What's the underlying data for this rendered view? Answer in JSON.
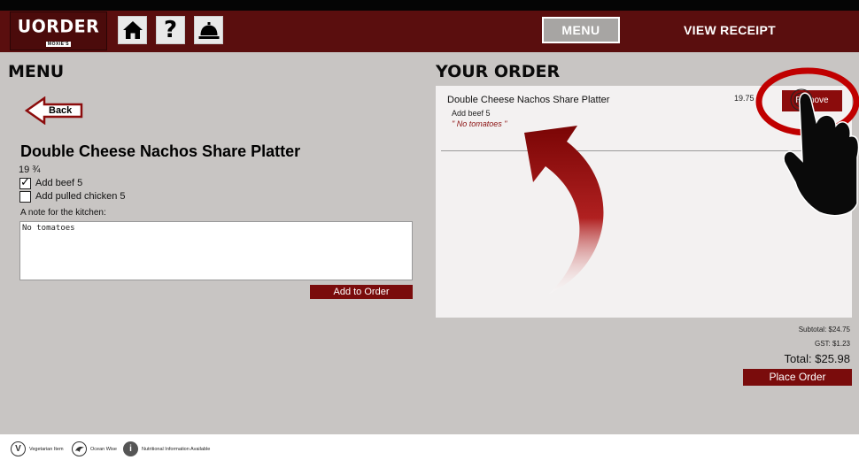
{
  "app": {
    "logo_text": "UORDER",
    "logo_sub": "MOXIE'S"
  },
  "header": {
    "icons": [
      "home-icon",
      "help-icon",
      "service-bell-icon"
    ],
    "help_glyph": "?",
    "menu_label": "MENU",
    "receipt_label": "VIEW RECEIPT"
  },
  "menu": {
    "heading": "MENU",
    "back_label": "Back",
    "item": {
      "title": "Double Cheese Nachos Share Platter",
      "price": "19 ¾",
      "options": [
        {
          "label": "Add beef 5",
          "checked": true
        },
        {
          "label": "Add pulled chicken 5",
          "checked": false
        }
      ],
      "note_label": "A note for the kitchen:",
      "note_value": "No tomatoes",
      "add_label": "Add to Order"
    }
  },
  "order": {
    "heading": "YOUR ORDER",
    "items": [
      {
        "name": "Double Cheese Nachos Share Platter",
        "price": "19.75",
        "modifier": "Add beef 5",
        "note": "\" No tomatoes \"",
        "remove_label": "Remove"
      }
    ],
    "subtotal": "Subtotal: $24.75",
    "gst": "GST: $1.23",
    "total": "Total: $25.98",
    "place_label": "Place Order"
  },
  "footer": {
    "legend": [
      {
        "glyph": "V",
        "label": "Vegetarian Item",
        "icon": "vegetarian-icon"
      },
      {
        "glyph": "",
        "label": "Ocean Wise",
        "icon": "ocean-wise-icon"
      },
      {
        "glyph": "i",
        "label": "Nutritional Information Available",
        "icon": "info-icon"
      }
    ]
  },
  "colors": {
    "brand": "#5a0e0e",
    "button": "#7a0c0c",
    "background": "#c8c5c3",
    "annotation": "#c00000"
  }
}
